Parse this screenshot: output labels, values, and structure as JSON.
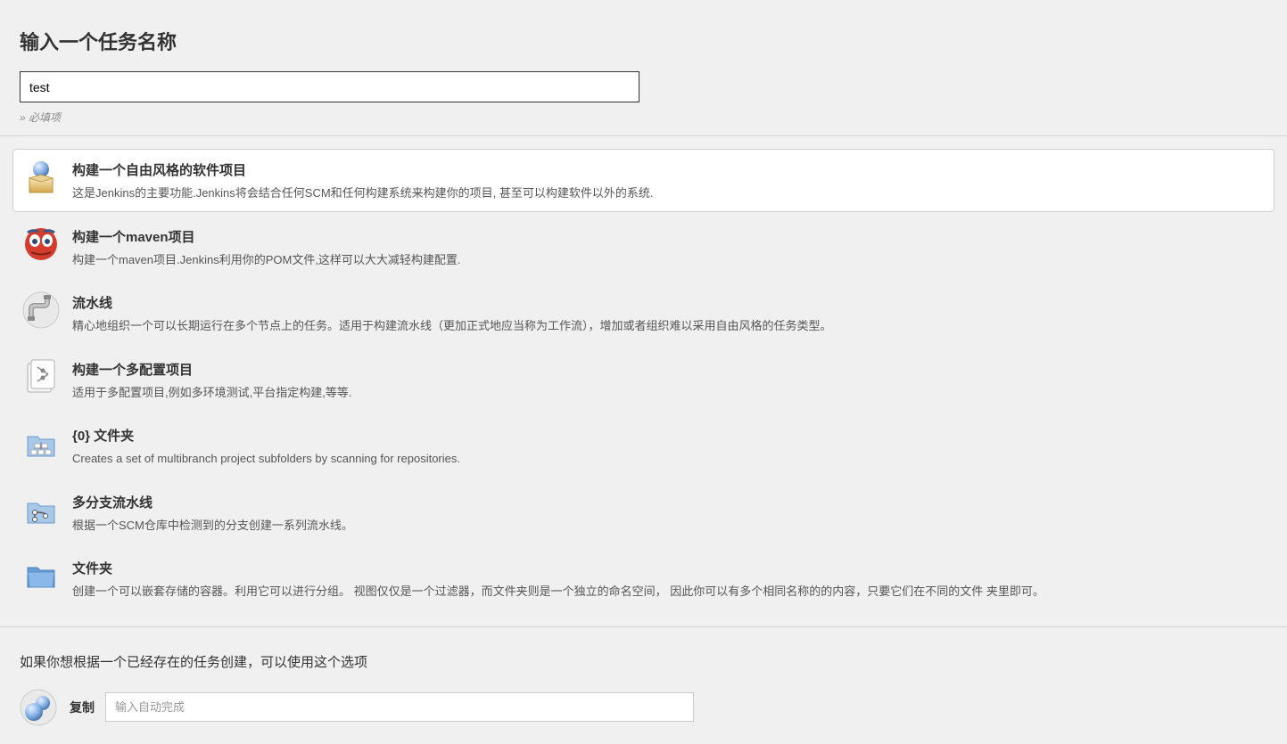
{
  "header": {
    "title": "输入一个任务名称",
    "item_name_value": "test",
    "required_hint": "» 必填项"
  },
  "categories": [
    {
      "id": "freestyle",
      "title": "构建一个自由风格的软件项目",
      "desc": "这是Jenkins的主要功能.Jenkins将会结合任何SCM和任何构建系统来构建你的项目, 甚至可以构建软件以外的系统.",
      "selected": true
    },
    {
      "id": "maven",
      "title": "构建一个maven项目",
      "desc": "构建一个maven项目.Jenkins利用你的POM文件,这样可以大大减轻构建配置.",
      "selected": false
    },
    {
      "id": "pipeline",
      "title": "流水线",
      "desc": "精心地组织一个可以长期运行在多个节点上的任务。适用于构建流水线（更加正式地应当称为工作流），增加或者组织难以采用自由风格的任务类型。",
      "selected": false
    },
    {
      "id": "multiconfig",
      "title": "构建一个多配置项目",
      "desc": "适用于多配置项目,例如多环境测试,平台指定构建,等等.",
      "selected": false
    },
    {
      "id": "orgfolder",
      "title": "{0} 文件夹",
      "desc": "Creates a set of multibranch project subfolders by scanning for repositories.",
      "selected": false
    },
    {
      "id": "multibranch",
      "title": "多分支流水线",
      "desc": "根据一个SCM仓库中检测到的分支创建一系列流水线。",
      "selected": false
    },
    {
      "id": "folder",
      "title": "文件夹",
      "desc": "创建一个可以嵌套存储的容器。利用它可以进行分组。 视图仅仅是一个过滤器，而文件夹则是一个独立的命名空间， 因此你可以有多个相同名称的的内容，只要它们在不同的文件 夹里即可。",
      "selected": false
    }
  ],
  "copy": {
    "prompt": "如果你想根据一个已经存在的任务创建，可以使用这个选项",
    "label": "复制",
    "placeholder": "输入自动完成"
  }
}
